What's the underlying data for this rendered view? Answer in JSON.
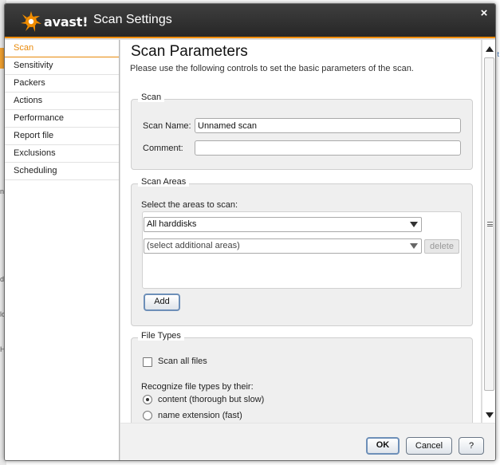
{
  "dialog": {
    "brand": "avast!",
    "title": "Scan Settings",
    "close_label": "×"
  },
  "sidebar": {
    "items": [
      {
        "label": "Scan",
        "active": true
      },
      {
        "label": "Sensitivity"
      },
      {
        "label": "Packers"
      },
      {
        "label": "Actions"
      },
      {
        "label": "Performance"
      },
      {
        "label": "Report file"
      },
      {
        "label": "Exclusions"
      },
      {
        "label": "Scheduling"
      }
    ]
  },
  "main": {
    "title": "Scan Parameters",
    "description": "Please use the following controls to set the basic parameters of the scan.",
    "scan_group": {
      "legend": "Scan",
      "name_label": "Scan Name:",
      "name_value": "Unnamed scan",
      "comment_label": "Comment:",
      "comment_value": ""
    },
    "areas_group": {
      "legend": "Scan Areas",
      "select_label": "Select the areas to scan:",
      "primary_area": "All harddisks",
      "additional_area": "(select additional areas)",
      "delete_label": "delete",
      "add_label": "Add"
    },
    "file_types_group": {
      "legend": "File Types",
      "scan_all_label": "Scan all files",
      "scan_all_checked": false,
      "recognize_label": "Recognize file types by their:",
      "options": [
        {
          "label": "content (thorough but slow)",
          "checked": true
        },
        {
          "label": "name extension (fast)",
          "checked": false
        }
      ]
    }
  },
  "footer": {
    "ok_label": "OK",
    "cancel_label": "Cancel",
    "help_label": "?"
  },
  "background": {
    "fragments": [
      "t",
      "ni",
      "d",
      "lo",
      "H"
    ]
  },
  "colors": {
    "accent": "#e8890a",
    "titlebar": "#2e2e2e",
    "logo_orange": "#f08c00"
  }
}
